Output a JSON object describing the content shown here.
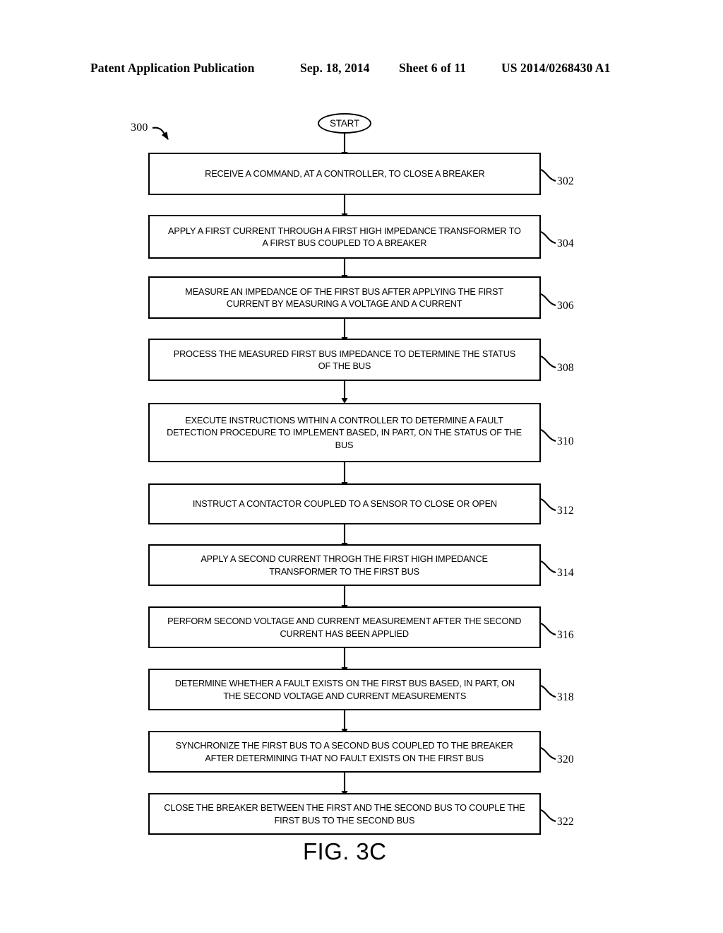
{
  "header": {
    "publication": "Patent Application Publication",
    "date": "Sep. 18, 2014",
    "sheet": "Sheet 6 of 11",
    "patent_number": "US 2014/0268430 A1"
  },
  "figure": {
    "caption": "FIG. 3C",
    "diagram_ref": "300",
    "start_label": "START",
    "line_color": "#000000",
    "background_color": "#ffffff",
    "steps": [
      {
        "ref": "302",
        "text": "RECEIVE A COMMAND, AT A CONTROLLER, TO CLOSE A BREAKER"
      },
      {
        "ref": "304",
        "text": "APPLY A FIRST CURRENT THROUGH A FIRST HIGH IMPEDANCE TRANSFORMER TO\nA FIRST BUS COUPLED TO A BREAKER"
      },
      {
        "ref": "306",
        "text": "MEASURE AN IMPEDANCE OF THE FIRST BUS AFTER APPLYING THE FIRST\nCURRENT BY MEASURING A VOLTAGE AND A CURRENT"
      },
      {
        "ref": "308",
        "text": "PROCESS THE MEASURED FIRST BUS IMPEDANCE TO DETERMINE THE STATUS\nOF THE BUS"
      },
      {
        "ref": "310",
        "text": "EXECUTE INSTRUCTIONS WITHIN A CONTROLLER TO DETERMINE A FAULT\nDETECTION PROCEDURE TO IMPLEMENT BASED, IN PART, ON THE STATUS OF THE\nBUS"
      },
      {
        "ref": "312",
        "text": "INSTRUCT A CONTACTOR COUPLED TO A SENSOR TO CLOSE OR OPEN"
      },
      {
        "ref": "314",
        "text": "APPLY A SECOND CURRENT THROGH THE FIRST HIGH IMPEDANCE\nTRANSFORMER TO THE FIRST BUS"
      },
      {
        "ref": "316",
        "text": "PERFORM SECOND VOLTAGE AND CURRENT MEASUREMENT AFTER THE SECOND\nCURRENT HAS BEEN APPLIED"
      },
      {
        "ref": "318",
        "text": "DETERMINE WHETHER A FAULT EXISTS ON THE FIRST BUS BASED, IN PART, ON\nTHE SECOND VOLTAGE AND CURRENT MEASUREMENTS"
      },
      {
        "ref": "320",
        "text": "SYNCHRONIZE THE FIRST BUS TO A SECOND BUS COUPLED TO THE BREAKER\nAFTER DETERMINING THAT NO FAULT EXISTS ON THE FIRST BUS"
      },
      {
        "ref": "322",
        "text": "CLOSE THE BREAKER BETWEEN THE FIRST AND THE SECOND BUS TO COUPLE THE\nFIRST BUS TO THE SECOND BUS"
      }
    ]
  }
}
